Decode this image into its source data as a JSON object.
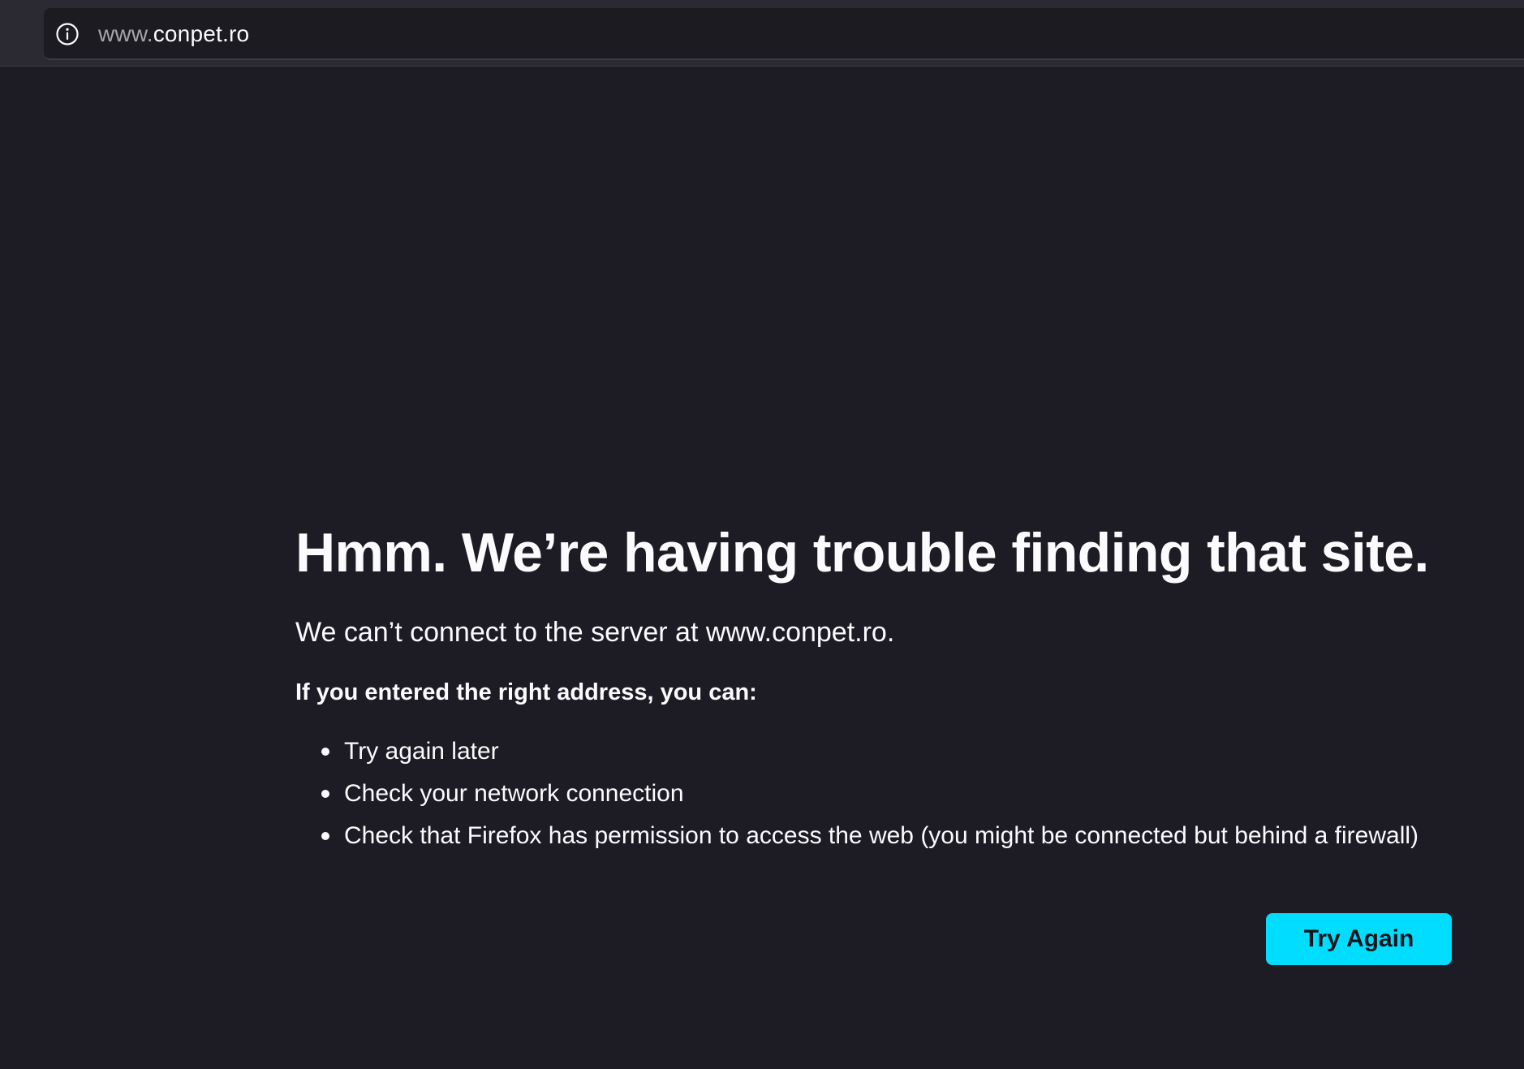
{
  "urlbar": {
    "icon": "info-icon",
    "url_prefix": "www.",
    "url_domain": "conpet.ro"
  },
  "error_page": {
    "title": "Hmm. We’re having trouble finding that site.",
    "description": "We can’t connect to the server at www.conpet.ro.",
    "subheading": "If you entered the right address, you can:",
    "suggestions": [
      "Try again later",
      "Check your network connection",
      "Check that Firefox has permission to access the web (you might be connected but behind a firewall)"
    ],
    "try_again_label": "Try Again"
  },
  "colors": {
    "page_background": "#1d1c24",
    "toolbar_background": "#2b2a33",
    "urlbar_background": "#1c1b22",
    "text": "#fbfbfe",
    "accent_button": "#00ddff"
  }
}
